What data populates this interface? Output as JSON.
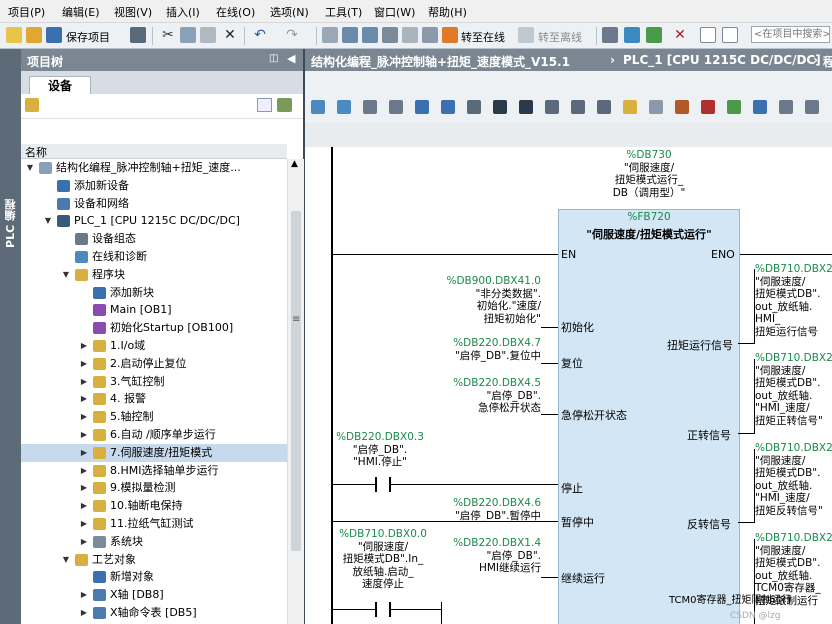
{
  "menubar": [
    "项目(P)",
    "编辑(E)",
    "视图(V)",
    "插入(I)",
    "在线(O)",
    "选项(N)",
    "工具(T)",
    "窗口(W)",
    "帮助(H)"
  ],
  "toolbar": {
    "save_project": "保存项目",
    "go_online": "转至在线",
    "go_offline": "转至离线",
    "search_placeholder": "<在项目中搜索>"
  },
  "left_strip": "PLC 编程",
  "project_tree": {
    "title": "项目树",
    "devices_tab": "设备",
    "column_name": "名称",
    "items": [
      {
        "label": "结构化编程_脉冲控制轴+扭矩_速度...",
        "level": 0,
        "arrow": "down",
        "icon": "project-icon"
      },
      {
        "label": "添加新设备",
        "level": 1,
        "arrow": "",
        "icon": "add-device-icon"
      },
      {
        "label": "设备和网络",
        "level": 1,
        "arrow": "",
        "icon": "network-icon"
      },
      {
        "label": "PLC_1 [CPU 1215C DC/DC/DC]",
        "level": 1,
        "arrow": "down",
        "icon": "plc-icon"
      },
      {
        "label": "设备组态",
        "level": 2,
        "arrow": "",
        "icon": "device-config-icon"
      },
      {
        "label": "在线和诊断",
        "level": 2,
        "arrow": "",
        "icon": "diagnostics-icon"
      },
      {
        "label": "程序块",
        "level": 2,
        "arrow": "down",
        "icon": "folder-icon"
      },
      {
        "label": "添加新块",
        "level": 3,
        "arrow": "",
        "icon": "add-block-icon"
      },
      {
        "label": "Main [OB1]",
        "level": 3,
        "arrow": "",
        "icon": "ob-icon"
      },
      {
        "label": "初始化Startup [OB100]",
        "level": 3,
        "arrow": "",
        "icon": "ob-icon"
      },
      {
        "label": "1.I/o域",
        "level": 3,
        "arrow": "right",
        "icon": "folder-icon"
      },
      {
        "label": "2.启动停止复位",
        "level": 3,
        "arrow": "right",
        "icon": "folder-icon"
      },
      {
        "label": "3.气缸控制",
        "level": 3,
        "arrow": "right",
        "icon": "folder-icon"
      },
      {
        "label": "4. 报警",
        "level": 3,
        "arrow": "right",
        "icon": "folder-icon"
      },
      {
        "label": "5.轴控制",
        "level": 3,
        "arrow": "right",
        "icon": "folder-icon"
      },
      {
        "label": "6.自动 /顺序单步运行",
        "level": 3,
        "arrow": "right",
        "icon": "folder-icon"
      },
      {
        "label": "7.伺服速度/扭矩模式",
        "level": 3,
        "arrow": "right",
        "icon": "folder-icon",
        "selected": true
      },
      {
        "label": "8.HMI选择轴单步运行",
        "level": 3,
        "arrow": "right",
        "icon": "folder-icon"
      },
      {
        "label": "9.模拟量检测",
        "level": 3,
        "arrow": "right",
        "icon": "folder-icon"
      },
      {
        "label": "10.轴断电保持",
        "level": 3,
        "arrow": "right",
        "icon": "folder-icon"
      },
      {
        "label": "11.拉纸气缸测试",
        "level": 3,
        "arrow": "right",
        "icon": "folder-icon"
      },
      {
        "label": "系统块",
        "level": 3,
        "arrow": "right",
        "icon": "system-block-icon"
      },
      {
        "label": "工艺对象",
        "level": 2,
        "arrow": "down",
        "icon": "folder-icon"
      },
      {
        "label": "新增对象",
        "level": 3,
        "arrow": "",
        "icon": "add-object-icon"
      },
      {
        "label": "X轴 [DB8]",
        "level": 3,
        "arrow": "right",
        "icon": "axis-icon"
      },
      {
        "label": "X轴命令表 [DB5]",
        "level": 3,
        "arrow": "right",
        "icon": "axis-icon"
      }
    ]
  },
  "editor": {
    "breadcrumb": [
      "结构化编程_脉冲控制轴+扭矩_速度模式_V15.1",
      "PLC_1 [CPU 1215C DC/DC/DC]",
      "程"
    ],
    "block": {
      "instance_addr": "%DB730",
      "instance_name": [
        "\"伺服速度/",
        "扭矩模式运行_",
        "DB（调用型）\""
      ],
      "fb_addr": "%FB720",
      "fb_name": "\"伺服速度/扭矩模式运行\"",
      "en": "EN",
      "eno": "ENO",
      "inputs": [
        {
          "pin": "初始化",
          "addr": "%DB900.DBX41.0",
          "lines": [
            "\"非分类数据\".",
            "初始化.\"速度/",
            "扭矩初始化\""
          ]
        },
        {
          "pin": "复位",
          "addr": "%DB220.DBX4.7",
          "lines": [
            "\"启停_DB\".复位中"
          ]
        },
        {
          "pin": "急停松开状态",
          "addr": "%DB220.DBX4.5",
          "lines": [
            "\"启停_DB\".",
            "急停松开状态"
          ]
        },
        {
          "pin": "停止",
          "addr": "%DB220.DBX0.3",
          "lines": [
            "\"启停_DB\".",
            "\"HMI.停止\""
          ]
        },
        {
          "pin": "暂停中",
          "addr": "%DB220.DBX4.6",
          "lines": [
            "\"启停_DB\".暂停中"
          ]
        },
        {
          "pin": "继续运行",
          "addr": "%DB220.DBX1.4",
          "lines": [
            "\"启停_DB\".",
            "HMI继续运行"
          ]
        },
        {
          "pin": "",
          "addr": "%DB710.DBX0.0",
          "lines": [
            "\"伺服速度/",
            "扭矩模式DB\".In_",
            "放纸轴.启动_",
            "速度停止"
          ]
        }
      ],
      "outputs": [
        {
          "pin": "扭矩运行信号",
          "addr": "%DB710.DBX2.",
          "lines": [
            "\"伺服速度/",
            "扭矩模式DB\".",
            "out_放纸轴.",
            "HMI_",
            "扭矩运行信号"
          ]
        },
        {
          "pin": "正转信号",
          "addr": "%DB710.DBX2.",
          "lines": [
            "\"伺服速度/",
            "扭矩模式DB\".",
            "out_放纸轴.",
            "\"HMI_速度/",
            "扭矩正转信号\""
          ]
        },
        {
          "pin": "反转信号",
          "addr": "%DB710.DBX2.",
          "lines": [
            "\"伺服速度/",
            "扭矩模式DB\".",
            "out_放纸轴.",
            "\"HMI_速度/",
            "扭矩反转信号\""
          ]
        },
        {
          "pin": "TCM0寄存器_扭矩限制运行",
          "addr": "%DB710.DBX2.",
          "lines": [
            "\"伺服速度/",
            "扭矩模式DB\".",
            "out_放纸轴.",
            "TCM0寄存器_",
            "扭矩限制运行"
          ]
        }
      ]
    },
    "watermark": "CSDN @lzg"
  },
  "colors": {
    "panel_header": "#7a8793",
    "toolbar_bg": "#eef1f4",
    "tree_selected": "#c7d9ec",
    "fb_block": "#d2e6f5",
    "address_green": "#1a8a4a",
    "left_strip": "#5d6b78"
  }
}
